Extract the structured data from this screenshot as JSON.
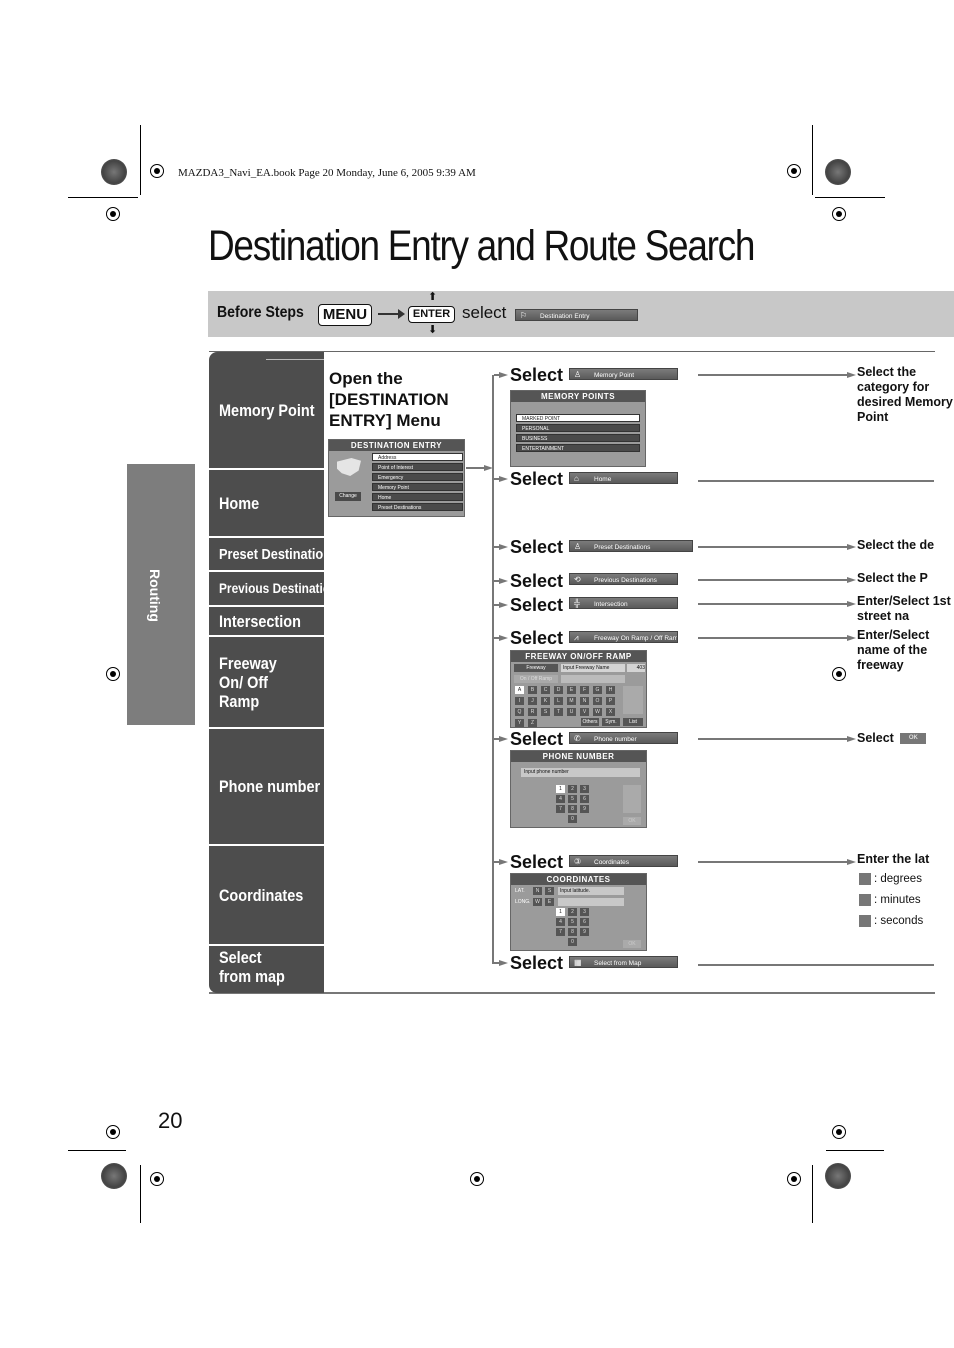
{
  "header_note": "MAZDA3_Navi_EA.book  Page 20  Monday, June 6, 2005  9:39 AM",
  "page_title": "Destination Entry and Route Search",
  "before_steps": {
    "label": "Before Steps",
    "menu_key": "MENU",
    "enter_key": "ENTER",
    "select_word": "select",
    "menu_item": "Destination Entry"
  },
  "side_tab": "Routing",
  "categories": [
    "Memory Point",
    "Home",
    "Preset Destination",
    "Previous Destination",
    "Intersection",
    "Freeway On/ Off Ramp",
    "Phone number",
    "Coordinates",
    "Select from map"
  ],
  "open_menu": {
    "title": "Open the [DESTINATION ENTRY] Menu",
    "screen_title": "DESTINATION ENTRY",
    "change_button": "Change",
    "items": [
      "Address",
      "Point of Interest",
      "Emergency",
      "Memory Point",
      "Home",
      "Preset Destinations"
    ]
  },
  "select_word": "Select",
  "selections": [
    {
      "button": "Memory Point",
      "icon": "person-pin-icon"
    },
    {
      "button": "Home",
      "icon": "home-icon"
    },
    {
      "button": "Preset Destinations",
      "icon": "person-pin-icon"
    },
    {
      "button": "Previous Destinations",
      "icon": "history-icon"
    },
    {
      "button": "Intersection",
      "icon": "intersection-icon"
    },
    {
      "button": "Freeway On Ramp / Off Ramp",
      "icon": "freeway-icon"
    },
    {
      "button": "Phone number",
      "icon": "phone-icon"
    },
    {
      "button": "Coordinates",
      "icon": "coordinates-icon"
    },
    {
      "button": "Select from Map",
      "icon": "map-icon"
    }
  ],
  "memory_points_screen": {
    "title": "MEMORY POINTS",
    "items": [
      "MARKED POINT",
      "PERSONAL",
      "BUSINESS",
      "ENTERTAINMENT"
    ]
  },
  "freeway_screen": {
    "title": "FREEWAY ON/OFF RAMP",
    "freeway_btn": "Freeway",
    "input_placeholder": "Input Freeway Name",
    "count": "403",
    "ramp_btn": "On / Off Ramp",
    "keys": [
      "A",
      "B",
      "C",
      "D",
      "E",
      "F",
      "G",
      "H",
      "I",
      "J",
      "K",
      "L",
      "M",
      "N",
      "O",
      "P",
      "Q",
      "R",
      "S",
      "T",
      "U",
      "V",
      "W",
      "X",
      "Y",
      "Z"
    ],
    "others": "Others",
    "sym": "Sym.",
    "list": "List"
  },
  "phone_screen": {
    "title": "PHONE NUMBER",
    "input_placeholder": "Input phone number",
    "keys": [
      "1",
      "2",
      "3",
      "4",
      "5",
      "6",
      "7",
      "8",
      "9",
      "0"
    ],
    "ok": "OK"
  },
  "coordinates_screen": {
    "title": "COORDINATES",
    "lat_label": "LAT.",
    "long_label": "LONG.",
    "n": "N",
    "s": "S",
    "w": "W",
    "e": "E",
    "input_placeholder": "Input latitude.",
    "keys": [
      "1",
      "2",
      "3",
      "4",
      "5",
      "6",
      "7",
      "8",
      "9",
      "0"
    ],
    "ok": "OK"
  },
  "descriptions": {
    "memory": "Select the category for desired Memory Point",
    "preset": "Select the de",
    "previous": "Select the P",
    "intersection": "Enter/Select 1st street na",
    "freeway": "Enter/Select name of the freeway",
    "phone_select": "Select",
    "phone_ok": "OK",
    "coord": "Enter the lat"
  },
  "coord_legend": [
    ": degrees",
    ": minutes",
    ": seconds"
  ],
  "page_number": "20"
}
